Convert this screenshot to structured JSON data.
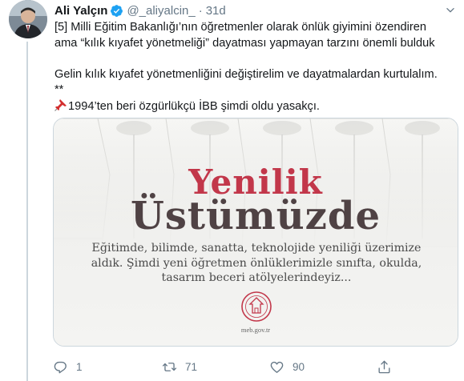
{
  "tweet": {
    "author_name": "Ali Yalçın",
    "handle": "@_aliyalcin_",
    "separator": "·",
    "time": "31d",
    "text_lines": [
      "[5] Milli Eğitim Bakanlığı’nın öğretmenler olarak önlük giyimini özendiren",
      "ama “kılık kıyafet yönetmeliği” dayatması yapmayan tarzını önemli bulduk",
      "",
      "Gelin kılık kıyafet yönetmenliğini değiştirelim ve dayatmalardan kurtulalım.",
      "**",
      "1994’ten beri özgürlükçü İBB şimdi oldu yasakçı."
    ],
    "pin_icon": "pushpin-icon"
  },
  "media": {
    "headline_line1": "Yenilik",
    "headline_line2": "Üstümüzde",
    "body_lines": [
      "Eğitimde, bilimde, sanatta, teknolojide yeniliği üzerimize",
      "aldık. Şimdi yeni öğretmen önlüklerimizle sınıfta, okulda,",
      "tasarım beceri atölyelerindeyiz..."
    ],
    "site": "meb.gov.tr"
  },
  "actions": {
    "reply_count": "1",
    "retweet_count": "71",
    "like_count": "90",
    "reply_icon": "reply-icon",
    "retweet_icon": "retweet-icon",
    "like_icon": "heart-icon",
    "share_icon": "share-icon"
  },
  "colors": {
    "name": "#14171a",
    "secondary": "#657786",
    "verified": "#1da1f2",
    "headline_red": "#c2374a",
    "headline_dark": "#4f4244"
  }
}
